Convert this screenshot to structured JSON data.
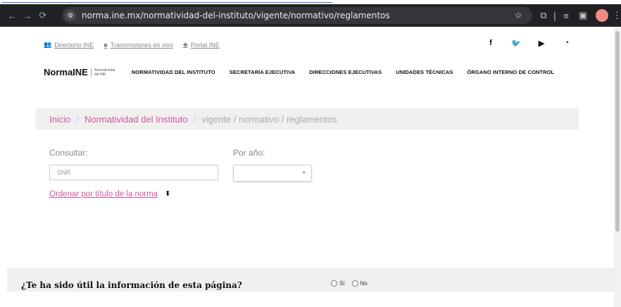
{
  "browser": {
    "url": "norma.ine.mx/normatividad-del-instituto/vigente/normativo/reglamentos",
    "back": "←",
    "forward": "→",
    "reload": "⟳",
    "star": "☆"
  },
  "utility_links": [
    {
      "icon": "users-icon",
      "glyph": "👥",
      "label": "Directorio INE"
    },
    {
      "icon": "video-icon",
      "glyph": "■",
      "label": "Transmisiones en vivo"
    },
    {
      "icon": "diamond-icon",
      "glyph": "◆",
      "label": "Portal INE"
    }
  ],
  "social": [
    {
      "icon": "facebook-icon",
      "glyph": "f"
    },
    {
      "icon": "twitter-icon",
      "glyph": "🐦"
    },
    {
      "icon": "youtube-icon",
      "glyph": "▶"
    },
    {
      "icon": "rss-icon",
      "glyph": "◔"
    }
  ],
  "brand": {
    "name": "NormaINE",
    "sub": "Normatividad del INE"
  },
  "nav": [
    "NORMATIVIDAD DEL INSTITUTO",
    "SECRETARÍA EJECUTIVA",
    "DIRECCIONES EJECUTIVAS",
    "UNIDADES TÉCNICAS",
    "ÓRGANO INTERNO DE CONTROL"
  ],
  "breadcrumb": {
    "home": "Inicio",
    "section": "Normatividad del Instituto",
    "current": "vigente / normativo / reglamentos",
    "separator": "/"
  },
  "filters": {
    "consultar_label": "Consultar:",
    "consultar_placeholder": "SNR",
    "year_label": "Por año:",
    "year_selected": ""
  },
  "order_link": "Ordenar por título de la norma ",
  "order_icon": "⬍",
  "feedback": {
    "question": "¿Te ha sido útil la información de esta página?",
    "yes": "Sí",
    "no": "No"
  }
}
